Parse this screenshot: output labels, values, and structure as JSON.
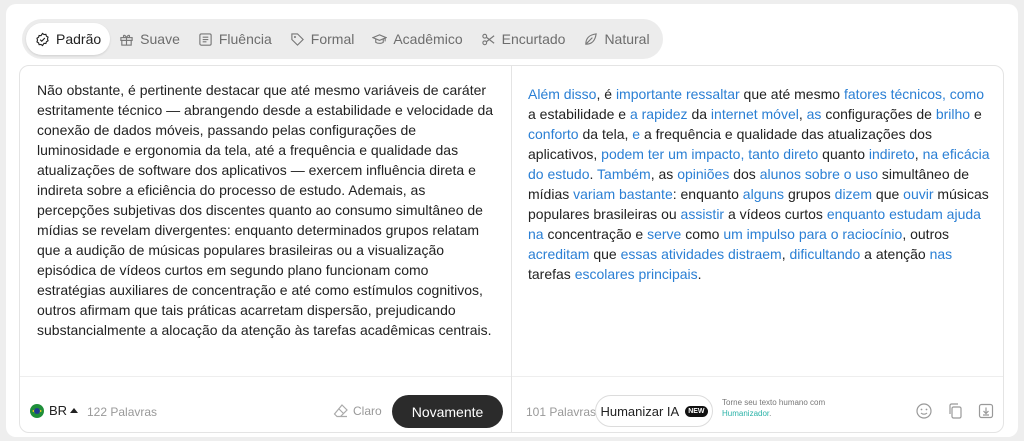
{
  "modes": [
    {
      "label": "Padrão",
      "icon": "badge-check-icon",
      "active": true
    },
    {
      "label": "Suave",
      "icon": "gift-icon",
      "active": false
    },
    {
      "label": "Fluência",
      "icon": "text-lines-icon",
      "active": false
    },
    {
      "label": "Formal",
      "icon": "tag-icon",
      "active": false
    },
    {
      "label": "Acadêmico",
      "icon": "graduation-cap-icon",
      "active": false
    },
    {
      "label": "Encurtado",
      "icon": "scissors-icon",
      "active": false
    },
    {
      "label": "Natural",
      "icon": "leaf-icon",
      "active": false
    }
  ],
  "input": {
    "text": "Não obstante, é pertinente destacar que até mesmo variáveis de caráter estritamente técnico — abrangendo desde a estabilidade e velocidade da conexão de dados móveis, passando pelas configurações de luminosidade e ergonomia da tela, até a frequência e qualidade das atualizações de software dos aplicativos — exercem influência direta e indireta sobre a eficiência do processo de estudo. Ademais, as percepções subjetivas dos discentes quanto ao consumo simultâneo de mídias se revelam divergentes: enquanto determinados grupos relatam que a audição de músicas populares brasileiras ou a visualização episódica de vídeos curtos em segundo plano funcionam como estratégias auxiliares de concentração e até como estímulos cognitivos, outros afirmam que tais práticas acarretam dispersão, prejudicando substancialmente a alocação da atenção às tarefas acadêmicas centrais.",
    "language": "BR",
    "word_count": "122 Palavras",
    "clear_label": "Claro",
    "again_label": "Novamente"
  },
  "output": {
    "segments": [
      {
        "t": "Além disso",
        "h": true
      },
      {
        "t": ", é ",
        "h": false
      },
      {
        "t": "importante ressaltar",
        "h": true
      },
      {
        "t": " que até mesmo ",
        "h": false
      },
      {
        "t": "fatores técnicos, como",
        "h": true
      },
      {
        "t": " a estabilidade e ",
        "h": false
      },
      {
        "t": "a rapidez",
        "h": true
      },
      {
        "t": " da ",
        "h": false
      },
      {
        "t": "internet móvel",
        "h": true
      },
      {
        "t": ", ",
        "h": false
      },
      {
        "t": "as",
        "h": true
      },
      {
        "t": " configurações de ",
        "h": false
      },
      {
        "t": "brilho",
        "h": true
      },
      {
        "t": " e ",
        "h": false
      },
      {
        "t": "conforto",
        "h": true
      },
      {
        "t": " da tela, ",
        "h": false
      },
      {
        "t": "e",
        "h": true
      },
      {
        "t": " a frequência e qualidade das atualizações dos aplicativos, ",
        "h": false
      },
      {
        "t": "podem ter um impacto, tanto direto",
        "h": true
      },
      {
        "t": " quanto ",
        "h": false
      },
      {
        "t": "indireto",
        "h": true
      },
      {
        "t": ", ",
        "h": false
      },
      {
        "t": "na eficácia do estudo",
        "h": true
      },
      {
        "t": ". ",
        "h": false
      },
      {
        "t": "Também",
        "h": true
      },
      {
        "t": ", as ",
        "h": false
      },
      {
        "t": "opiniões",
        "h": true
      },
      {
        "t": " dos ",
        "h": false
      },
      {
        "t": "alunos sobre o uso",
        "h": true
      },
      {
        "t": " simultâneo de mídias ",
        "h": false
      },
      {
        "t": "variam bastante",
        "h": true
      },
      {
        "t": ": enquanto ",
        "h": false
      },
      {
        "t": "alguns",
        "h": true
      },
      {
        "t": " grupos ",
        "h": false
      },
      {
        "t": "dizem",
        "h": true
      },
      {
        "t": " que ",
        "h": false
      },
      {
        "t": "ouvir",
        "h": true
      },
      {
        "t": " músicas populares brasileiras ou ",
        "h": false
      },
      {
        "t": "assistir",
        "h": true
      },
      {
        "t": " a vídeos curtos ",
        "h": false
      },
      {
        "t": "enquanto estudam ajuda na",
        "h": true
      },
      {
        "t": " concentração e ",
        "h": false
      },
      {
        "t": "serve",
        "h": true
      },
      {
        "t": " como ",
        "h": false
      },
      {
        "t": "um impulso para o raciocínio",
        "h": true
      },
      {
        "t": ", outros ",
        "h": false
      },
      {
        "t": "acreditam",
        "h": true
      },
      {
        "t": " que ",
        "h": false
      },
      {
        "t": "essas atividades distraem",
        "h": true
      },
      {
        "t": ", ",
        "h": false
      },
      {
        "t": "dificultando",
        "h": true
      },
      {
        "t": " a atenção ",
        "h": false
      },
      {
        "t": "nas",
        "h": true
      },
      {
        "t": " tarefas ",
        "h": false
      },
      {
        "t": "escolares principais",
        "h": true
      },
      {
        "t": ".",
        "h": false
      }
    ],
    "word_count": "101 Palavras",
    "humanize_label": "Humanizar IA",
    "new_badge": "NEW",
    "promo_text": "Torne seu texto humano com",
    "promo_link": "Humanizador",
    "promo_end": "."
  },
  "colors": {
    "highlight": "#2a7fd4",
    "button_dark": "#2b2b2b",
    "promo_link": "#2bb3a8"
  }
}
